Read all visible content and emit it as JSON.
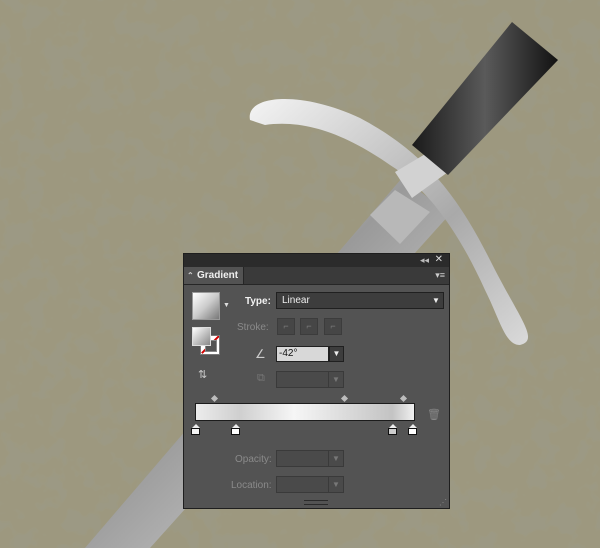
{
  "panel": {
    "tab_label": "Gradient",
    "tab_chevron": "⌃",
    "collapse_glyph": "◂◂",
    "close_glyph": "✕",
    "menu_glyph": "▾≡",
    "type_label": "Type:",
    "type_value": "Linear",
    "stroke_label": "Stroke:",
    "angle_value": "-42°",
    "opacity_label": "Opacity:",
    "location_label": "Location:"
  },
  "icons": {
    "dropdown": "▼",
    "preview_menu": "▼",
    "angle": "∠",
    "aspect": "⧉",
    "reverse": "⇅",
    "trash": "🗑",
    "resize": "⋰"
  },
  "gradient": {
    "stops": [
      {
        "color": "#f4f4f4",
        "selected": false
      },
      {
        "color": "#ffffff",
        "selected": false
      },
      {
        "color": "#cdcdcd",
        "selected": false
      },
      {
        "color": "#ffffff",
        "selected": false
      }
    ]
  },
  "colors": {
    "panel_bg": "#535353",
    "background_texture": "#8c876e",
    "stroke_none_slash": "#d10000"
  }
}
